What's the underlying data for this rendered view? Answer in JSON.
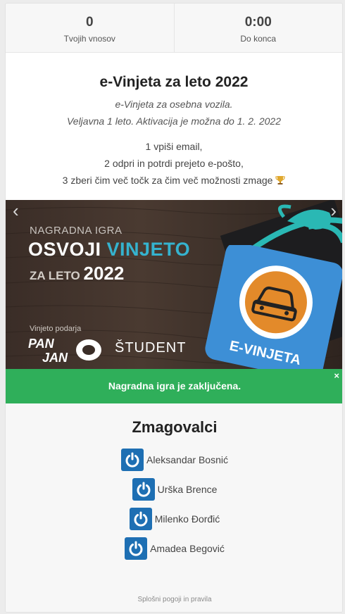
{
  "stats": [
    {
      "value": "0",
      "label": "Tvojih vnosov"
    },
    {
      "value": "0:00",
      "label": "Do konca"
    }
  ],
  "intro": {
    "title": "e-Vinjeta za leto 2022",
    "subtitle_1": "e-Vinjeta za osebna vozila.",
    "subtitle_2": "Veljavna 1 leto. Aktivacija je možna do 1. 2. 2022",
    "step_1": "1 vpiši email,",
    "step_2": "2 odpri in potrdi prejeto e-pošto,",
    "step_3": "3 zberi čim več točk za čim več možnosti zmage",
    "trophy_icon": "trophy-icon"
  },
  "banner": {
    "line_1": "NAGRADNA IGRA",
    "line_2_a": "OSVOJI ",
    "line_2_b": "VINJETO",
    "line_3_a": "ZA LETO ",
    "line_3_b": "2022",
    "sponsor_label": "Vinjeto podarja",
    "sponsor_1_top": "PAN",
    "sponsor_1_bottom": "JAN",
    "sponsor_2": "ŠTUDENT",
    "badge_text": "E-VINJETA",
    "prev_arrow": "‹",
    "next_arrow": "›",
    "accent_color": "#35b3cf",
    "badge_color": "#3d8fd6",
    "ribbon_color": "#2ab8b4"
  },
  "notice": {
    "text": "Nagradna igra je zaključena.",
    "close": "×",
    "color": "#2faf5a"
  },
  "winners": {
    "title": "Zmagovalci",
    "items": [
      {
        "name": "Aleksandar Bosnić"
      },
      {
        "name": "Urška Brence"
      },
      {
        "name": "Milenko Đorđić"
      },
      {
        "name": "Amadea Begović"
      }
    ],
    "icon": "power-icon",
    "icon_color": "#1e6fb3"
  },
  "footer": {
    "terms": "Splošni pogoji in pravila"
  }
}
